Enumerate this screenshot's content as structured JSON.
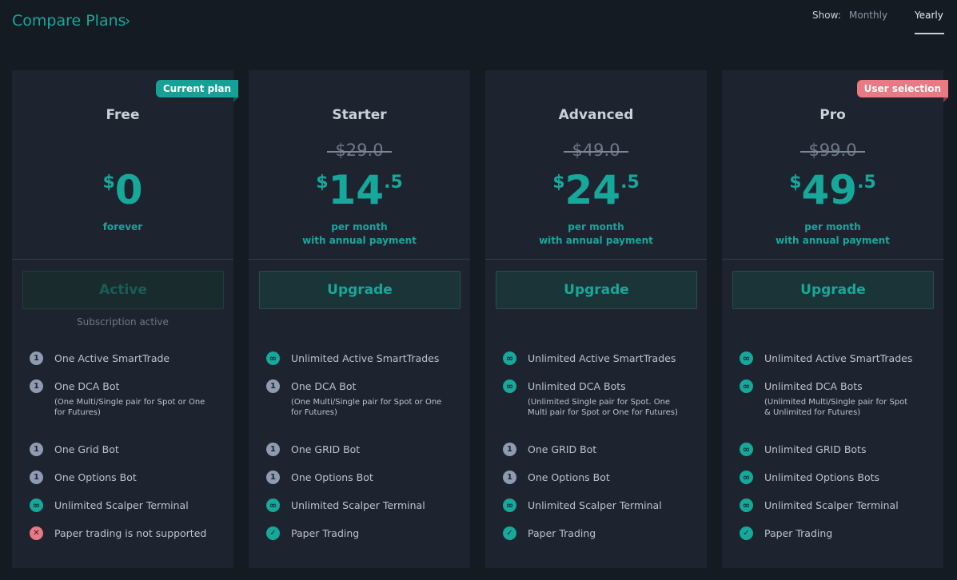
{
  "header": {
    "title": "Compare Plans",
    "chevron": "›",
    "show_label": "Show:",
    "periods": [
      "Monthly",
      "Yearly"
    ],
    "selected_period": "Yearly"
  },
  "plans": [
    {
      "name": "Free",
      "badge": "Current plan",
      "old_price": "",
      "currency": "$",
      "price": "0",
      "decimal": "",
      "period_line1": "forever",
      "period_line2": "",
      "action": "Active",
      "action_disabled": true,
      "status": "Subscription active",
      "features": [
        {
          "icon": "one",
          "label": "One Active SmartTrade",
          "note": ""
        },
        {
          "icon": "one",
          "label": "One DCA Bot",
          "note": "(One Multi/Single pair for Spot or One for Futures)"
        },
        {
          "icon": "one",
          "label": "One Grid Bot",
          "note": ""
        },
        {
          "icon": "one",
          "label": "One Options Bot",
          "note": ""
        },
        {
          "icon": "infinity",
          "label": "Unlimited Scalper Terminal",
          "note": ""
        },
        {
          "icon": "cross",
          "label": "Paper trading is not supported",
          "note": ""
        }
      ]
    },
    {
      "name": "Starter",
      "badge": "",
      "old_price": "$29.0",
      "currency": "$",
      "price": "14",
      "decimal": ".5",
      "period_line1": "per month",
      "period_line2": "with annual payment",
      "action": "Upgrade",
      "action_disabled": false,
      "status": "",
      "features": [
        {
          "icon": "infinity",
          "label": "Unlimited Active SmartTrades",
          "note": ""
        },
        {
          "icon": "one",
          "label": "One DCA Bot",
          "note": "(One Multi/Single pair for Spot or One for Futures)"
        },
        {
          "icon": "one",
          "label": "One GRID Bot",
          "note": ""
        },
        {
          "icon": "one",
          "label": "One Options Bot",
          "note": ""
        },
        {
          "icon": "infinity",
          "label": "Unlimited Scalper Terminal",
          "note": ""
        },
        {
          "icon": "check",
          "label": "Paper Trading",
          "note": ""
        }
      ]
    },
    {
      "name": "Advanced",
      "badge": "",
      "old_price": "$49.0",
      "currency": "$",
      "price": "24",
      "decimal": ".5",
      "period_line1": "per month",
      "period_line2": "with annual payment",
      "action": "Upgrade",
      "action_disabled": false,
      "status": "",
      "features": [
        {
          "icon": "infinity",
          "label": "Unlimited Active SmartTrades",
          "note": ""
        },
        {
          "icon": "infinity",
          "label": "Unlimited DCA Bots",
          "note": "(Unlimited Single pair for Spot. One Multi pair for Spot or One for Futures)"
        },
        {
          "icon": "one",
          "label": "One GRID Bot",
          "note": ""
        },
        {
          "icon": "one",
          "label": "One Options Bot",
          "note": ""
        },
        {
          "icon": "infinity",
          "label": "Unlimited Scalper Terminal",
          "note": ""
        },
        {
          "icon": "check",
          "label": "Paper Trading",
          "note": ""
        }
      ]
    },
    {
      "name": "Pro",
      "badge": "User selection",
      "old_price": "$99.0",
      "currency": "$",
      "price": "49",
      "decimal": ".5",
      "period_line1": "per month",
      "period_line2": "with annual payment",
      "action": "Upgrade",
      "action_disabled": false,
      "status": "",
      "features": [
        {
          "icon": "infinity",
          "label": "Unlimited Active SmartTrades",
          "note": ""
        },
        {
          "icon": "infinity",
          "label": "Unlimited DCA Bots",
          "note": "(Unlimited Multi/Single pair for Spot & Unlimited for Futures)"
        },
        {
          "icon": "infinity",
          "label": "Unlimited GRID Bots",
          "note": ""
        },
        {
          "icon": "infinity",
          "label": "Unlimited Options Bots",
          "note": ""
        },
        {
          "icon": "infinity",
          "label": "Unlimited Scalper Terminal",
          "note": ""
        },
        {
          "icon": "check",
          "label": "Paper Trading",
          "note": ""
        }
      ]
    }
  ],
  "icon_glyphs": {
    "one": "1",
    "infinity": "∞",
    "check": "✓",
    "cross": "✕"
  },
  "colors": {
    "accent": "#16a89a",
    "badge_current": "#17a095",
    "badge_user": "#e97982",
    "background": "#151b23",
    "card": "#1d2430"
  }
}
